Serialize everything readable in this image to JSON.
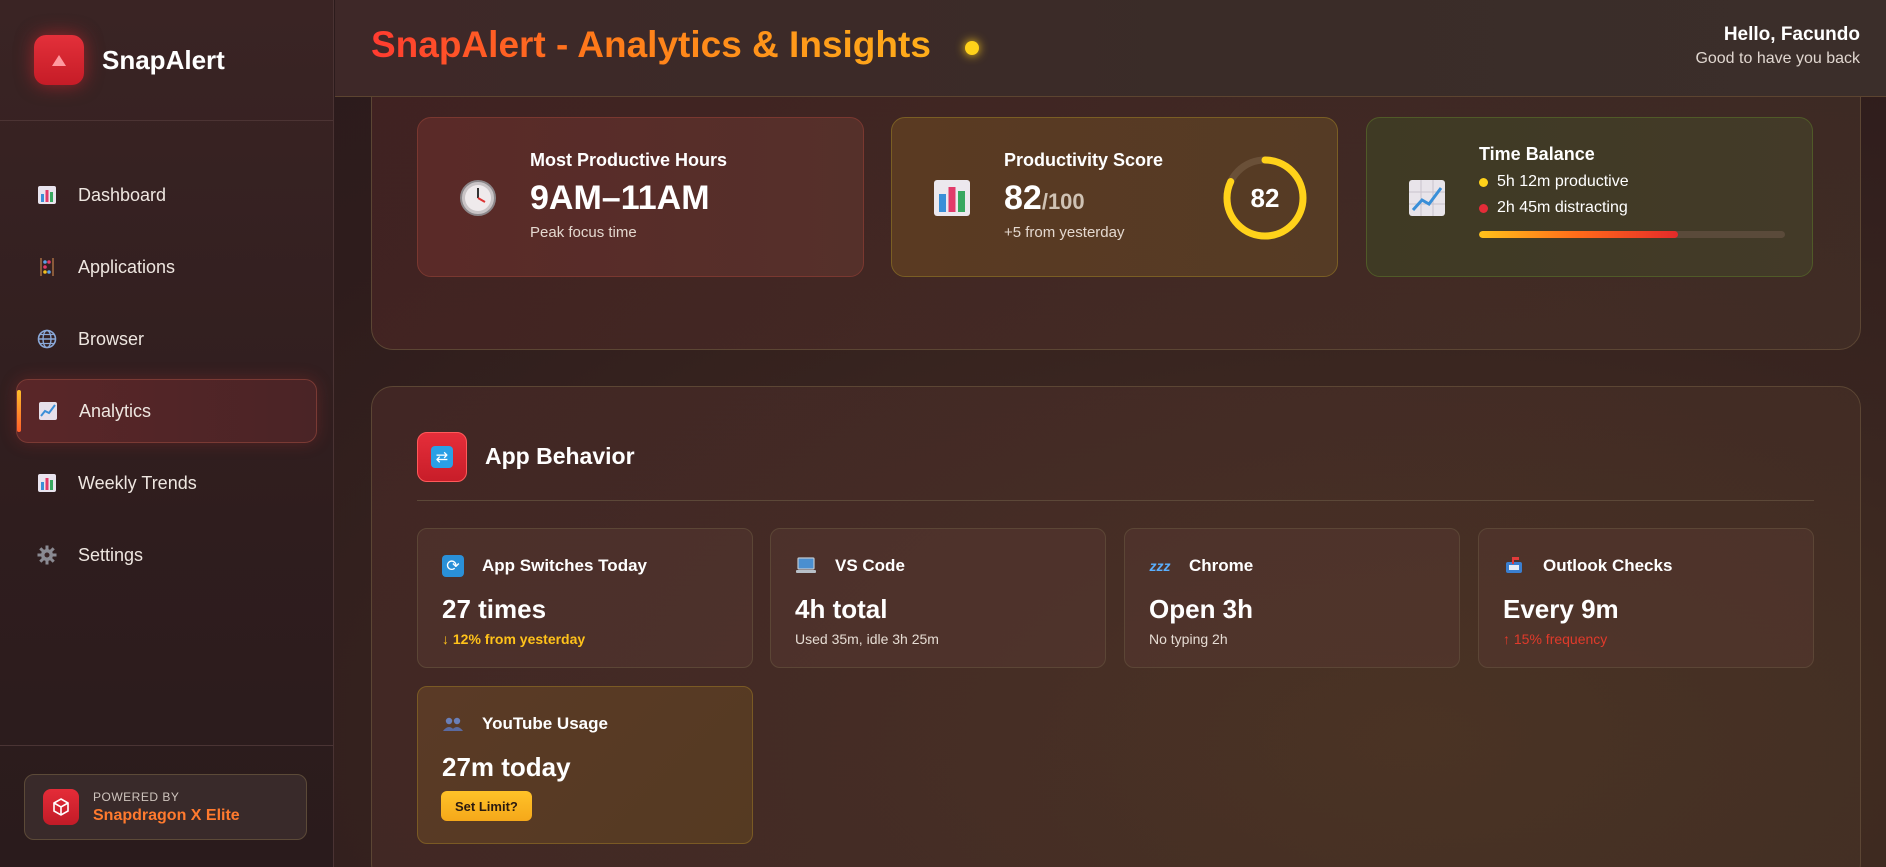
{
  "app": {
    "name": "SnapAlert"
  },
  "sidebar": {
    "items": [
      {
        "label": "Dashboard",
        "icon": "bar-chart-icon"
      },
      {
        "label": "Applications",
        "icon": "abacus-icon"
      },
      {
        "label": "Browser",
        "icon": "globe-icon"
      },
      {
        "label": "Analytics",
        "icon": "trend-chart-icon",
        "active": true
      },
      {
        "label": "Weekly Trends",
        "icon": "bar-chart-icon"
      },
      {
        "label": "Settings",
        "icon": "gear-icon"
      }
    ],
    "powered_by": {
      "line1": "POWERED BY",
      "line2": "Snapdragon X Elite"
    }
  },
  "header": {
    "title": "SnapAlert - Analytics & Insights",
    "greeting": "Hello, Facundo",
    "subgreeting": "Good to have you back"
  },
  "insights": {
    "productive_hours": {
      "label": "Most Productive Hours",
      "value": "9AM–11AM",
      "sub": "Peak focus time",
      "icon": "clock-icon"
    },
    "score": {
      "label": "Productivity Score",
      "value": "82",
      "denominator": "/100",
      "sub": "+5 from yesterday",
      "ring_value": "82",
      "percent": 82,
      "icon": "bar-chart-icon"
    },
    "time_balance": {
      "label": "Time Balance",
      "productive": "5h 12m productive",
      "distracting": "2h 45m distracting",
      "productive_fraction": 0.65,
      "icon": "chart-increasing-icon"
    }
  },
  "app_behavior": {
    "title": "App Behavior",
    "cards": [
      {
        "title": "App Switches Today",
        "value": "27 times",
        "sub": "↓ 12% from yesterday",
        "icon": "arrows-cycle-icon"
      },
      {
        "title": "VS Code",
        "value": "4h total",
        "sub": "Used 35m, idle 3h 25m",
        "icon": "laptop-icon"
      },
      {
        "title": "Chrome",
        "value": "Open 3h",
        "sub": "No typing 2h",
        "icon": "zzz-icon"
      },
      {
        "title": "Outlook Checks",
        "value": "Every 9m",
        "sub": "↑ 15% frequency",
        "icon": "mailbox-icon"
      },
      {
        "title": "YouTube Usage",
        "value": "27m today",
        "button": "Set Limit?",
        "icon": "people-icon"
      }
    ]
  },
  "colors": {
    "accent_red": "#e42c38",
    "accent_orange": "#ff7a1a",
    "accent_yellow": "#ffd21a",
    "distracting_red": "#e03a2a"
  }
}
